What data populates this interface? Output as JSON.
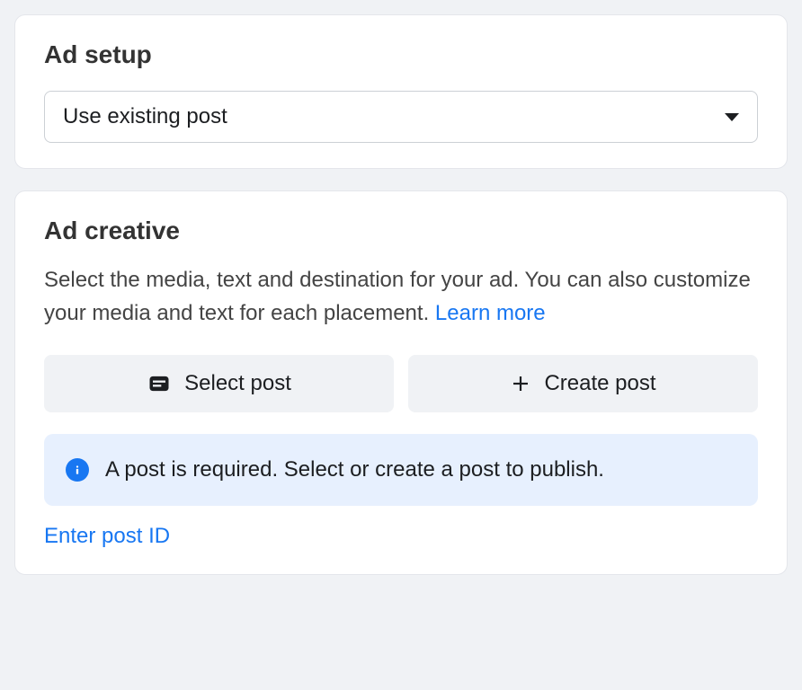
{
  "adSetup": {
    "title": "Ad setup",
    "dropdownValue": "Use existing post"
  },
  "adCreative": {
    "title": "Ad creative",
    "description": "Select the media, text and destination for your ad. You can also customize your media and text for each placement. ",
    "learnMoreLabel": "Learn more",
    "selectPostLabel": "Select post",
    "createPostLabel": "Create post",
    "infoMessage": "A post is required. Select or create a post to publish.",
    "enterPostIdLabel": "Enter post ID"
  }
}
